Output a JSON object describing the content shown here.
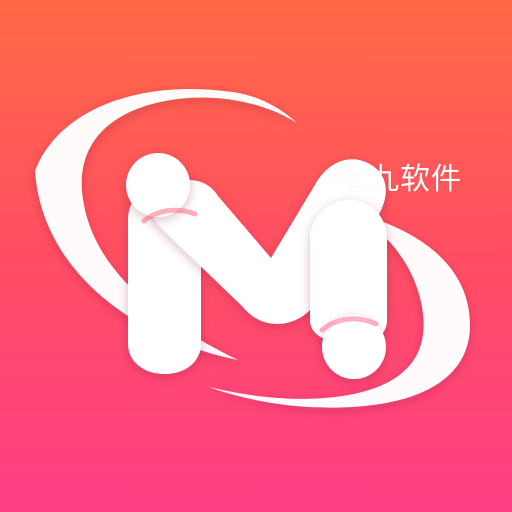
{
  "app_icon": {
    "logo": {
      "semantic": "stylized-letter-m-with-orbit-swooshes",
      "letter": "M"
    },
    "watermark_text": "七九软件",
    "colors": {
      "background_top": "#ff6a45",
      "background_middle": "#ff4f62",
      "background_bottom": "#ff3f86",
      "logo_fill": "#ffffff",
      "shadow": "#7a1f3c"
    }
  }
}
